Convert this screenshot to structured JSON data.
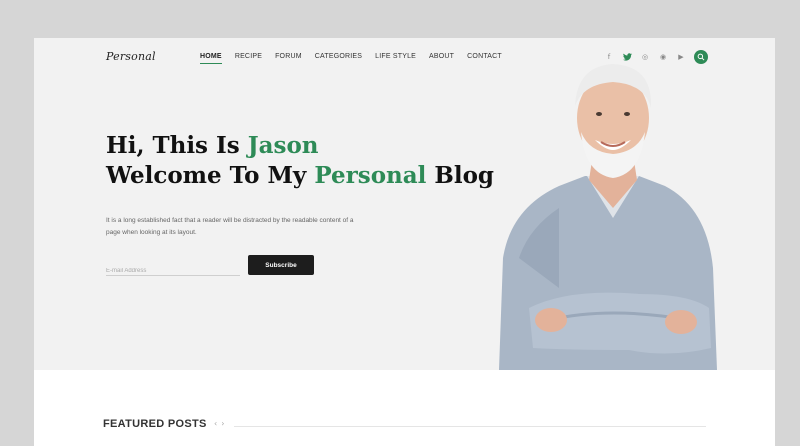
{
  "brand": {
    "logo": "Personal"
  },
  "nav": {
    "items": [
      {
        "label": "HOME",
        "active": true
      },
      {
        "label": "RECIPE",
        "active": false
      },
      {
        "label": "FORUM",
        "active": false
      },
      {
        "label": "CATEGORIES",
        "active": false
      },
      {
        "label": "LIFE STYLE",
        "active": false
      },
      {
        "label": "ABOUT",
        "active": false
      },
      {
        "label": "CONTACT",
        "active": false
      }
    ]
  },
  "socials": [
    {
      "icon": "facebook-icon",
      "glyph": "f"
    },
    {
      "icon": "twitter-icon",
      "glyph": "🐦"
    },
    {
      "icon": "instagram-icon",
      "glyph": "◎"
    },
    {
      "icon": "reddit-icon",
      "glyph": "◉"
    },
    {
      "icon": "youtube-icon",
      "glyph": "▶"
    }
  ],
  "hero": {
    "line1_pre": "Hi, This Is ",
    "line1_accent": "Jason",
    "line2_pre": "Welcome To My ",
    "line2_accent": "Personal",
    "line2_post": " Blog",
    "description": "It is a long established fact that a reader will be distracted by the readable content of a page when looking at its layout."
  },
  "newsletter": {
    "email_placeholder": "E-mail Address",
    "email_value": "",
    "subscribe_label": "Subscribe"
  },
  "featured": {
    "title": "FEATURED POSTS",
    "prev": "‹",
    "next": "›"
  },
  "colors": {
    "accent": "#2e8b57",
    "dark": "#1d1d1d",
    "bg": "#f2f2f2"
  }
}
